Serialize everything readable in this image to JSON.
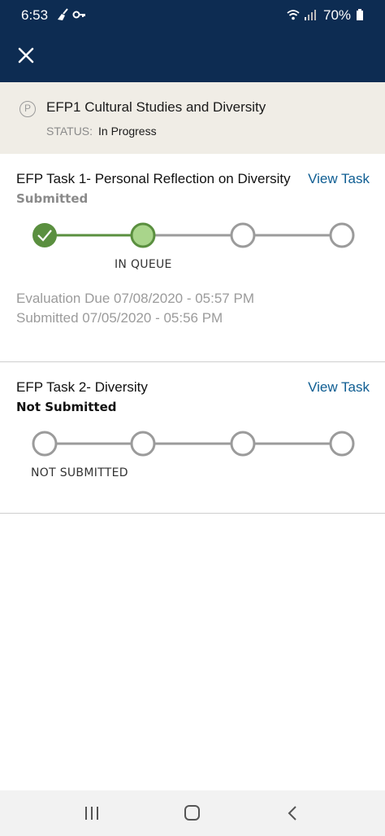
{
  "status_bar": {
    "time": "6:53",
    "battery": "70%",
    "icons": [
      "broom-icon",
      "key-icon",
      "wifi-icon",
      "signal-icon",
      "battery-icon"
    ]
  },
  "header": {
    "close_icon": "close-icon",
    "background": "#0d2c52"
  },
  "course": {
    "badge": "P",
    "title": "EFP1 Cultural Studies and Diversity",
    "status_label": "STATUS:",
    "status_value": "In Progress"
  },
  "tasks": [
    {
      "title": "EFP Task 1- Personal Reflection on Diversity",
      "view_label": "View Task",
      "state": "Submitted",
      "progress_label": "IN QUEUE",
      "steps_completed": 1,
      "current_step": 2,
      "total_steps": 4,
      "evaluation_due": "Evaluation Due  07/08/2020 - 05:57 PM",
      "submitted": "Submitted  07/05/2020 - 05:56 PM"
    },
    {
      "title": "EFP Task 2- Diversity",
      "view_label": "View Task",
      "state": "Not Submitted",
      "progress_label": "NOT SUBMITTED",
      "steps_completed": 0,
      "current_step": 0,
      "total_steps": 4
    }
  ],
  "colors": {
    "accent_green": "#5a8f3f",
    "light_green": "#a9d58b",
    "link_blue": "#0e5d92",
    "step_gray": "#9b9b9b"
  },
  "nav": [
    "recent-apps-icon",
    "home-icon",
    "back-icon"
  ]
}
